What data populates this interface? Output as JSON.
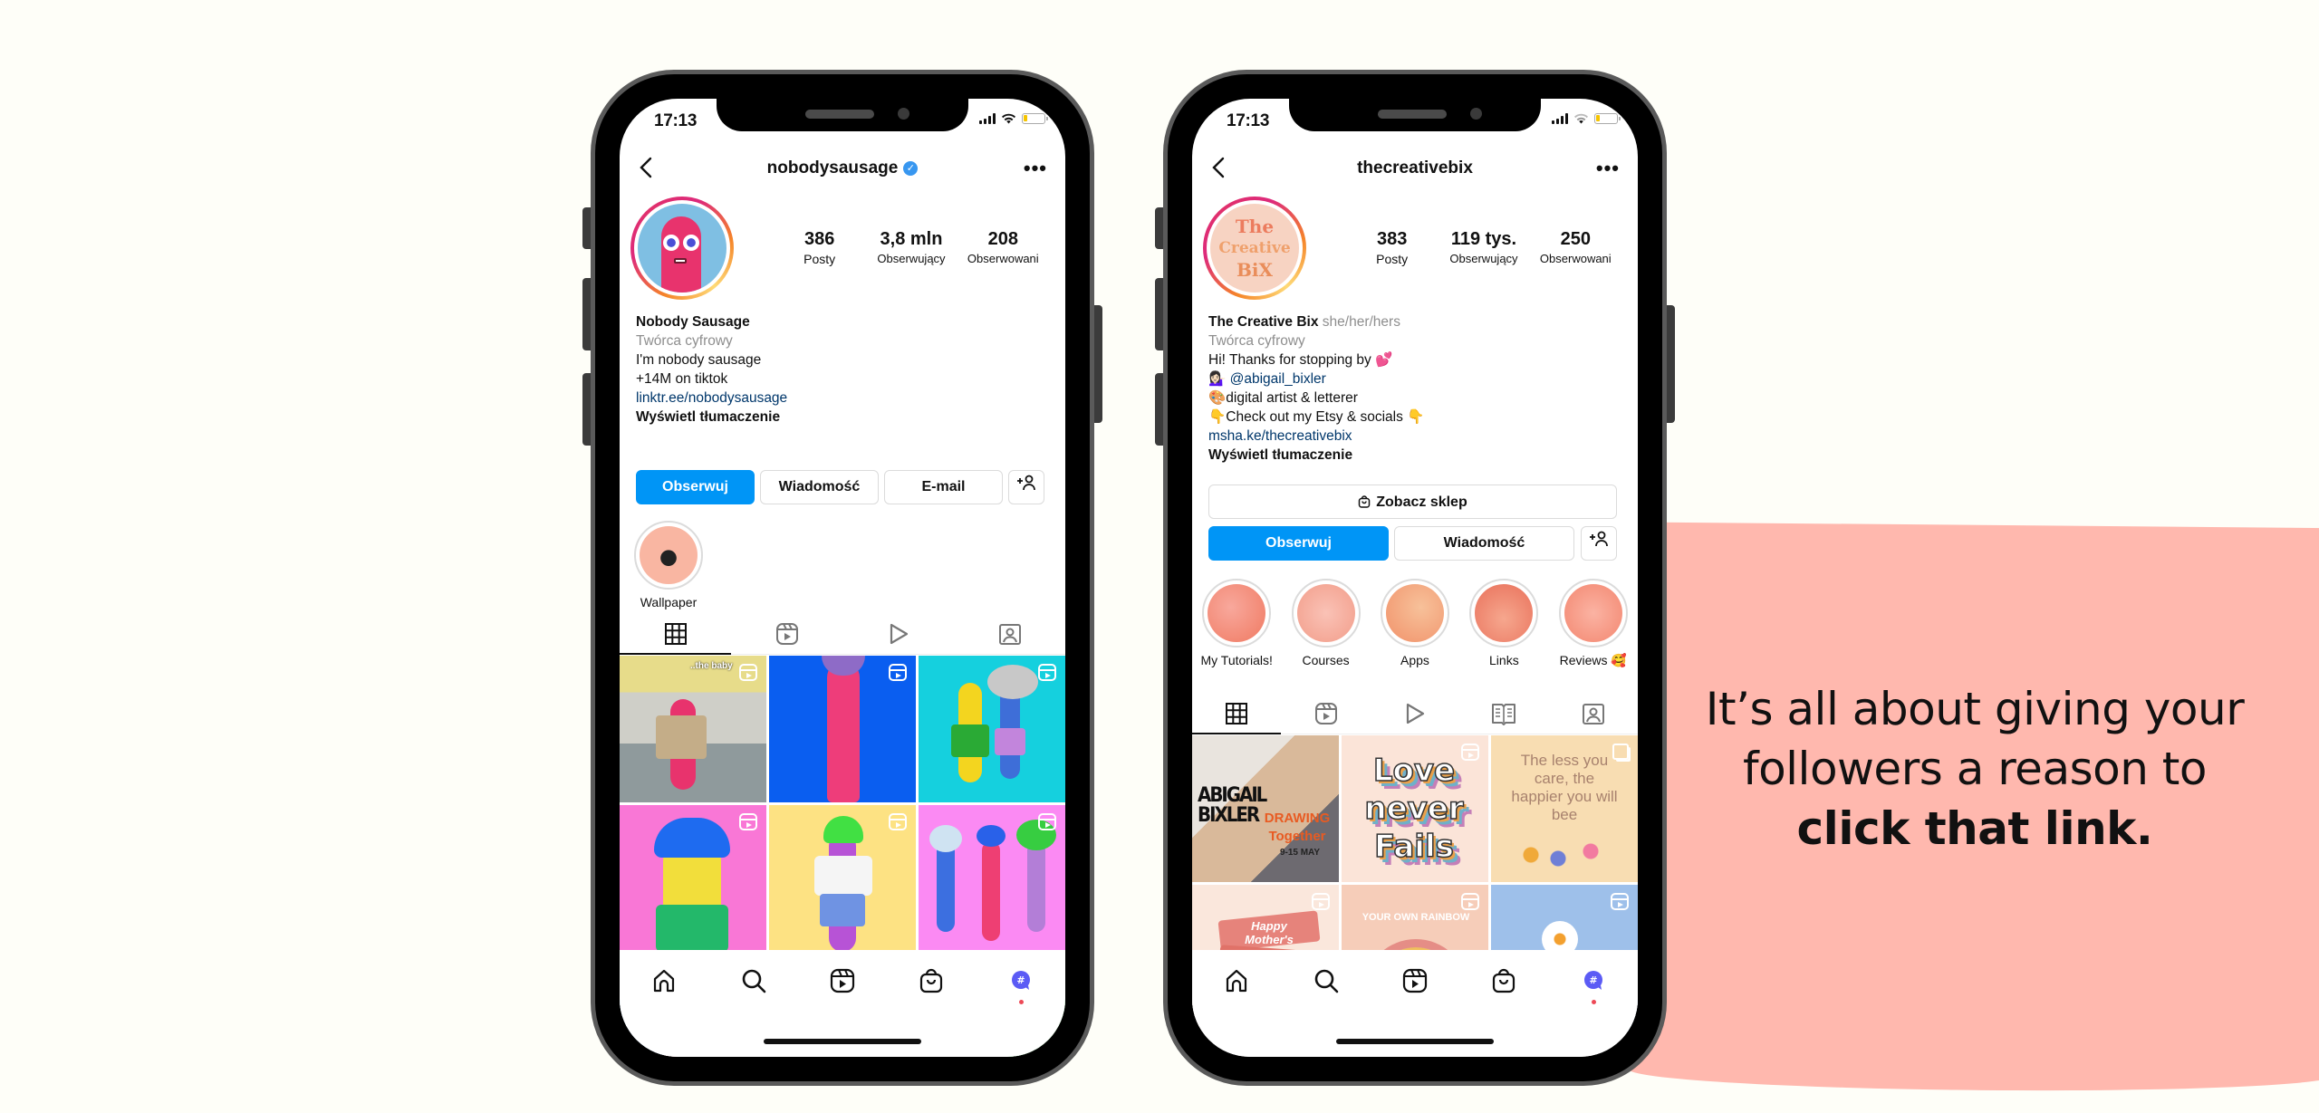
{
  "tagline": {
    "regular": "It’s all about giving your followers a reason to ",
    "bold": "click that link."
  },
  "colors": {
    "background": "#fefef8",
    "blob": "#ffb8ae",
    "primary_button": "#0095f6",
    "link": "#00376b",
    "muted": "#8e8e8e",
    "verified": "#3897f0",
    "notification_dot": "#ed4956"
  },
  "phones": [
    {
      "status_bar": {
        "time": "17:13"
      },
      "header": {
        "username": "nobodysausage",
        "verified": true,
        "back_icon": "chevron-left-icon",
        "more_icon": "more-dots-icon",
        "more_label": "•••"
      },
      "stats": [
        {
          "value": "386",
          "label": "Posty"
        },
        {
          "value": "3,8 mln",
          "label": "Obserwujący"
        },
        {
          "value": "208",
          "label": "Obserwowani"
        }
      ],
      "bio": {
        "name": "Nobody Sausage",
        "category": "Twórca cyfrowy",
        "lines": [
          "I'm nobody sausage",
          "+14M on tiktok"
        ],
        "link": "linktr.ee/nobodysausage",
        "translate": "Wyświetl tłumaczenie"
      },
      "buttons": {
        "follow": "Obserwuj",
        "message": "Wiadomość",
        "email": "E-mail",
        "add_user": "+👤"
      },
      "highlights": [
        {
          "label": "Wallpaper"
        }
      ],
      "tabs": [
        "grid",
        "reels",
        "videos",
        "tagged"
      ],
      "grid": [
        {
          "type": "reel",
          "caption": "..the baby",
          "alt": "pink sausage character in trench coat by pool"
        },
        {
          "type": "reel",
          "alt": "pink sausage character on blue background"
        },
        {
          "type": "reel",
          "alt": "two sausage characters on cyan background"
        },
        {
          "type": "reel",
          "alt": "yellow sausage with blue hair on pink background"
        },
        {
          "type": "reel",
          "alt": "purple sausage with green hair on yellow background"
        },
        {
          "type": "reel",
          "alt": "three sausage characters on pink background"
        },
        {
          "type": "reel",
          "alt": "partial thumbnail"
        },
        {
          "type": "reel",
          "alt": "partial thumbnail"
        },
        {
          "type": "reel",
          "alt": "partial thumbnail"
        }
      ],
      "bottom_nav": [
        "home",
        "search",
        "reels",
        "shop",
        "profile"
      ]
    },
    {
      "status_bar": {
        "time": "17:13"
      },
      "header": {
        "username": "thecreativebix",
        "verified": false,
        "back_icon": "chevron-left-icon",
        "more_icon": "more-dots-icon",
        "more_label": "•••"
      },
      "avatar_text": [
        "The",
        "Creative",
        "BiX"
      ],
      "stats": [
        {
          "value": "383",
          "label": "Posty"
        },
        {
          "value": "119 tys.",
          "label": "Obserwujący"
        },
        {
          "value": "250",
          "label": "Obserwowani"
        }
      ],
      "bio": {
        "name": "The Creative Bix",
        "pronouns": "she/her/hers",
        "category": "Twórca cyfrowy",
        "line1": "Hi! Thanks for stopping by 💕",
        "mention_emoji": "💁🏻‍♀️",
        "mention": "@abigail_bixler",
        "line3": "🎨digital artist & letterer",
        "line4": "👇Check out my Etsy & socials 👇",
        "link": "msha.ke/thecreativebix",
        "translate": "Wyświetl tłumaczenie"
      },
      "buttons": {
        "shop": "Zobacz sklep",
        "follow": "Obserwuj",
        "message": "Wiadomość",
        "add_user": "+👤"
      },
      "highlights": [
        {
          "label": "My Tutorials!"
        },
        {
          "label": "Courses"
        },
        {
          "label": "Apps"
        },
        {
          "label": "Links"
        },
        {
          "label": "Reviews 🥰"
        }
      ],
      "tabs": [
        "grid",
        "reels",
        "videos",
        "guides",
        "tagged"
      ],
      "grid": [
        {
          "type": "post",
          "title": "ABIGAIL BIXLER",
          "sub": "DRAWING Together",
          "date": "9-15 MAY"
        },
        {
          "type": "reel",
          "text": "Love never Fails"
        },
        {
          "type": "carousel",
          "text": "The less you care, the happier you will bee"
        },
        {
          "type": "reel",
          "text": "Happy Mother's"
        },
        {
          "type": "reel",
          "text": "YOUR OWN RAINBOW"
        },
        {
          "type": "reel",
          "alt": "daisies on blue background"
        }
      ],
      "bottom_nav": [
        "home",
        "search",
        "reels",
        "shop",
        "profile"
      ]
    }
  ]
}
